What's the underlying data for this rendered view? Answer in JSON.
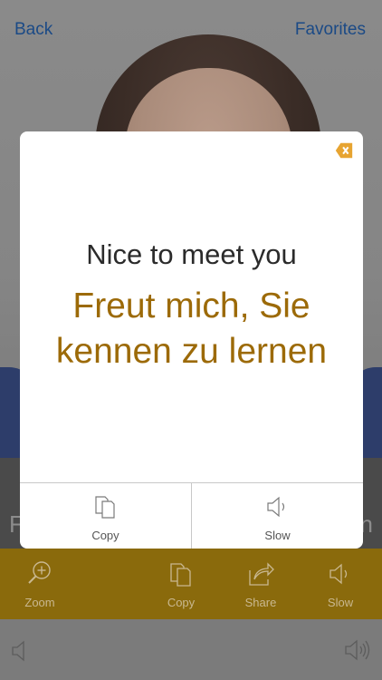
{
  "nav": {
    "back_label": "Back",
    "favorites_label": "Favorites"
  },
  "phrase_strip": {
    "left_text": "F",
    "right_text": "n"
  },
  "modal": {
    "english": "Nice to meet you",
    "german_line1": "Freut mich, Sie",
    "german_line2": "kennen zu lernen",
    "actions": [
      {
        "label": "Copy",
        "icon": "copy-icon"
      },
      {
        "label": "Slow",
        "icon": "speaker-icon"
      }
    ],
    "close_icon": "close-icon",
    "accent_color": "#9c6a08"
  },
  "toolbar": {
    "items": [
      {
        "label": "Zoom",
        "icon": "zoom-icon"
      },
      {
        "label": "Copy",
        "icon": "copy-icon"
      },
      {
        "label": "Share",
        "icon": "share-icon"
      },
      {
        "label": "Slow",
        "icon": "speaker-icon"
      }
    ],
    "background": "#8a6a0c"
  },
  "bottom_bar": {
    "left_icon": "speaker-icon",
    "right_icon": "speaker-loud-icon"
  }
}
